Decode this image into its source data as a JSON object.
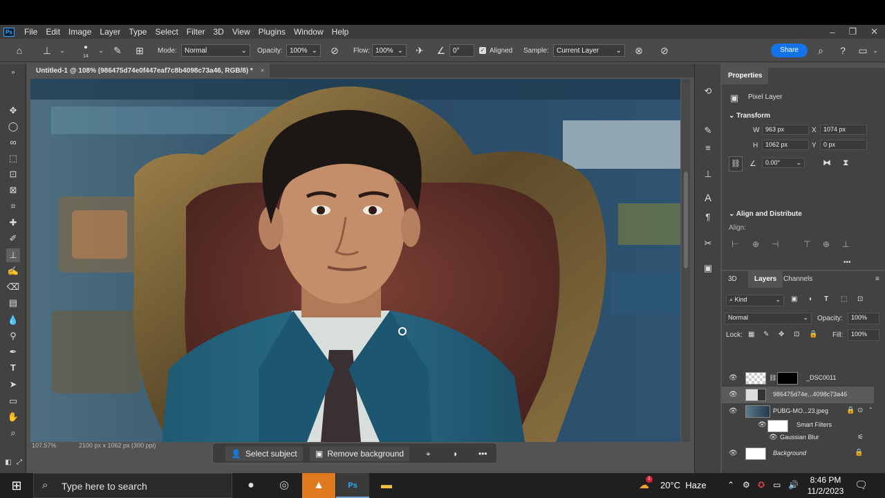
{
  "menu": {
    "logo": "Ps",
    "items": [
      "File",
      "Edit",
      "Image",
      "Layer",
      "Type",
      "Select",
      "Filter",
      "3D",
      "View",
      "Plugins",
      "Window",
      "Help"
    ]
  },
  "options": {
    "brush_size": "14",
    "mode_label": "Mode:",
    "mode_value": "Normal",
    "opacity_label": "Opacity:",
    "opacity_value": "100%",
    "flow_label": "Flow:",
    "flow_value": "100%",
    "angle_value": "0°",
    "aligned_label": "Aligned",
    "sample_label": "Sample:",
    "sample_value": "Current Layer",
    "share_label": "Share"
  },
  "document": {
    "tab_title": "Untitled-1 @ 108% (986475d74e0f447eaf7c8b4098c73a46, RGB/8) *",
    "tab_close": "×",
    "status_zoom": "107.57%",
    "status_size": "2100 px x 1062 px (300 ppi)"
  },
  "context_bar": {
    "select_subject": "Select subject",
    "remove_background": "Remove background",
    "more": "•••"
  },
  "properties": {
    "tab": "Properties",
    "layer_kind": "Pixel Layer",
    "transform_title": "Transform",
    "w_label": "W",
    "w_value": "963 px",
    "x_label": "X",
    "x_value": "1074 px",
    "h_label": "H",
    "h_value": "1062 px",
    "y_label": "Y",
    "y_value": "0 px",
    "angle_value": "0.00°",
    "align_title": "Align and Distribute",
    "align_label": "Align:",
    "more": "•••"
  },
  "layers_panel": {
    "tabs": [
      "3D",
      "Layers",
      "Channels"
    ],
    "kind_label": "Kind",
    "blend_mode": "Normal",
    "opacity_label": "Opacity:",
    "opacity_value": "100%",
    "lock_label": "Lock:",
    "fill_label": "Fill:",
    "fill_value": "100%",
    "layers": [
      {
        "name": "_DSC0011"
      },
      {
        "name": "986475d74e...4098c73a46"
      },
      {
        "name": "PUBG-MO...23.jpeg"
      },
      {
        "name": "Smart Filters"
      },
      {
        "name": "Gaussian Blur"
      },
      {
        "name": "Background"
      }
    ]
  },
  "taskbar": {
    "search_placeholder": "Type here to search",
    "weather": "20°C  Haze",
    "time": "8:46 PM",
    "date": "11/2/2023",
    "weather_badge": "1"
  }
}
